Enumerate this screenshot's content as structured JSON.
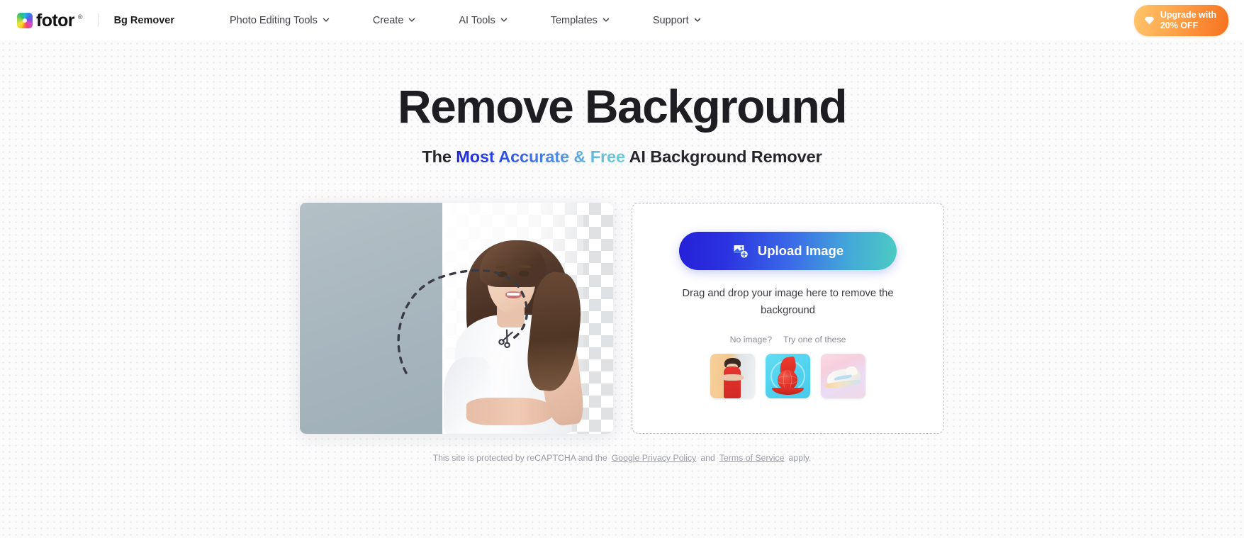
{
  "header": {
    "logo": {
      "icon": "fotor-rainbow-logo-icon",
      "word": "fotor",
      "registered": "®"
    },
    "product_name": "Bg Remover",
    "nav": [
      {
        "label": "Photo Editing Tools",
        "icon": "chevron-down-icon"
      },
      {
        "label": "Create",
        "icon": "chevron-down-icon"
      },
      {
        "label": "AI Tools",
        "icon": "chevron-down-icon"
      },
      {
        "label": "Templates",
        "icon": "chevron-down-icon"
      },
      {
        "label": "Support",
        "icon": "chevron-down-icon"
      }
    ],
    "upgrade": {
      "label": "Upgrade with\n20% OFF",
      "icon": "diamond-icon",
      "gradient_from": "#ffc56b",
      "gradient_to": "#f5721f"
    }
  },
  "hero": {
    "title": "Remove Background",
    "subtitle": {
      "lead": "The ",
      "highlight": "Most Accurate & Free",
      "trail": " AI Background Remover",
      "gradient_from": "#1f22dd",
      "gradient_to": "#6fcad9"
    }
  },
  "preview": {
    "name": "before-after-demo-image",
    "alt": "Woman photographed against a grey studio backdrop with the right half of the background removed to a transparent checkerboard",
    "cut_path_icon": "scissors-icon",
    "backdrop_color": "#a9b7bf",
    "checker_color": "#e0e1e3"
  },
  "upload_card": {
    "button": {
      "label": "Upload Image",
      "icon": "image-plus-icon",
      "gradient_from": "#2520d8",
      "gradient_to": "#4ccbc3"
    },
    "drop_hint": "Drag and drop your image here to remove the background",
    "try_prompt": "No image?",
    "try_label": "Try one of these",
    "samples": [
      {
        "name": "sample-woman-red-dress",
        "alt": "Woman in a red dress"
      },
      {
        "name": "sample-basketball-badge",
        "alt": "Basketball emblem on cyan background"
      },
      {
        "name": "sample-sneaker",
        "alt": "Pastel sneaker on pink background"
      }
    ]
  },
  "footer": {
    "text_before": "This site is protected by reCAPTCHA and the",
    "privacy_link": "Google Privacy Policy",
    "conjunction": "and",
    "terms_link": "Terms of Service",
    "text_after": "apply."
  }
}
